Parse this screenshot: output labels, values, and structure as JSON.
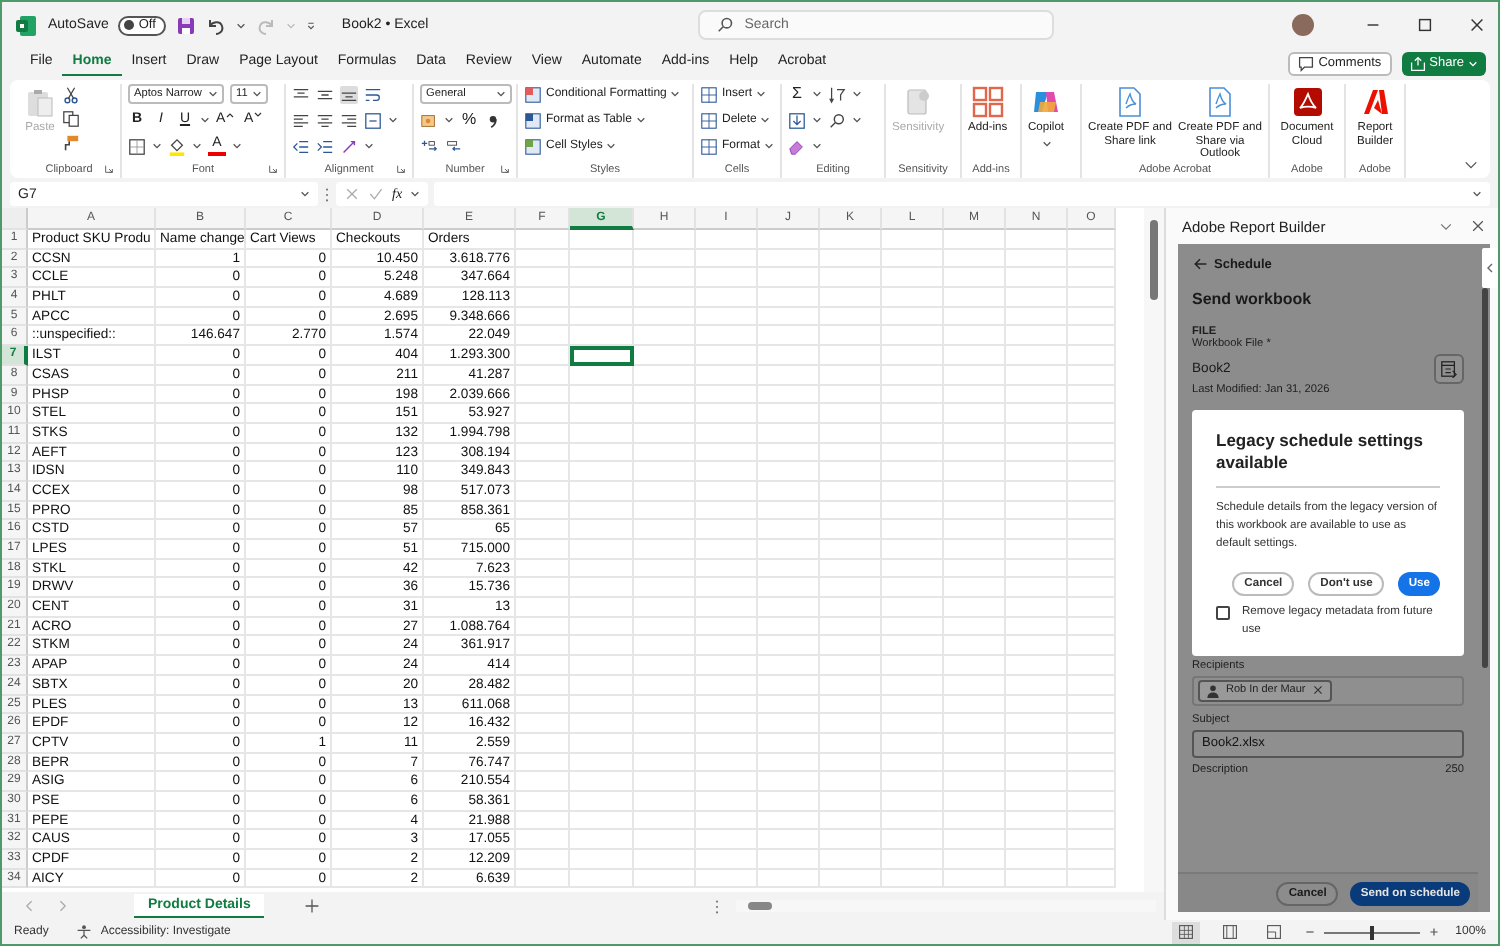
{
  "titlebar": {
    "autosave_label": "AutoSave",
    "autosave": {
      "on": false,
      "label": "Off"
    },
    "document_title": "Book2 • Excel",
    "search": {
      "placeholder": "Search"
    }
  },
  "menu_tabs": [
    {
      "label": "File",
      "selected": false
    },
    {
      "label": "Home",
      "selected": true
    },
    {
      "label": "Insert",
      "selected": false
    },
    {
      "label": "Draw",
      "selected": false
    },
    {
      "label": "Page Layout",
      "selected": false
    },
    {
      "label": "Formulas",
      "selected": false
    },
    {
      "label": "Data",
      "selected": false
    },
    {
      "label": "Review",
      "selected": false
    },
    {
      "label": "View",
      "selected": false
    },
    {
      "label": "Automate",
      "selected": false
    },
    {
      "label": "Add-ins",
      "selected": false
    },
    {
      "label": "Help",
      "selected": false
    },
    {
      "label": "Acrobat",
      "selected": false
    }
  ],
  "comments_button": "Comments",
  "share_button": "Share",
  "ribbon": {
    "clipboard": {
      "paste": {
        "label": "Paste",
        "disabled": true
      },
      "label": "Clipboard"
    },
    "font": {
      "family": "Aptos Narrow",
      "size": "11",
      "bold": "B",
      "italic": "I",
      "underline": "U",
      "grow": "A",
      "shrink": "A",
      "font_color_button": "A",
      "label": "Font"
    },
    "alignment": {
      "label": "Alignment"
    },
    "number": {
      "format": "General",
      "percent": "%",
      "label": "Number"
    },
    "styles": {
      "items": [
        "Conditional Formatting",
        "Format as Table",
        "Cell Styles"
      ],
      "label": "Styles"
    },
    "cells": {
      "items": [
        "Insert",
        "Delete",
        "Format"
      ],
      "label": "Cells"
    },
    "editing": {
      "autosum": "Σ",
      "label": "Editing"
    },
    "sensitivity": {
      "button": "Sensitivity",
      "disabled": true,
      "label": "Sensitivity"
    },
    "addins": {
      "button": "Add-ins",
      "label": "Add-ins"
    },
    "copilot": {
      "button": "Copilot"
    },
    "acrobat": {
      "buttons": [
        "Create PDF and Share link",
        "Create PDF and Share via Outlook"
      ],
      "label": "Adobe Acrobat"
    },
    "adobe": [
      {
        "button": "Document Cloud",
        "label": "Adobe"
      },
      {
        "button": "Report Builder",
        "label": "Adobe"
      }
    ]
  },
  "formula_bar": {
    "name_box": "G7",
    "function_label": "fx"
  },
  "sheet": {
    "columns": [
      {
        "label": "A",
        "selected": false
      },
      {
        "label": "B",
        "selected": false
      },
      {
        "label": "C",
        "selected": false
      },
      {
        "label": "D",
        "selected": false
      },
      {
        "label": "E",
        "selected": false
      },
      {
        "label": "F",
        "selected": false
      },
      {
        "label": "G",
        "selected": true
      },
      {
        "label": "H",
        "selected": false
      },
      {
        "label": "I",
        "selected": false
      },
      {
        "label": "J",
        "selected": false
      },
      {
        "label": "K",
        "selected": false
      },
      {
        "label": "L",
        "selected": false
      },
      {
        "label": "M",
        "selected": false
      },
      {
        "label": "N",
        "selected": false
      },
      {
        "label": "O",
        "selected": false
      }
    ],
    "rows": [
      {
        "number": "1",
        "selected": false,
        "cells": [
          "Product SKU Produ",
          "Name change",
          "Cart Views",
          "Checkouts",
          "Orders"
        ]
      },
      {
        "number": "2",
        "selected": false,
        "cells": [
          "CCSN",
          "1",
          "0",
          "10.450",
          "3.618.776"
        ]
      },
      {
        "number": "3",
        "selected": false,
        "cells": [
          "CCLE",
          "0",
          "0",
          "5.248",
          "347.664"
        ]
      },
      {
        "number": "4",
        "selected": false,
        "cells": [
          "PHLT",
          "0",
          "0",
          "4.689",
          "128.113"
        ]
      },
      {
        "number": "5",
        "selected": false,
        "cells": [
          "APCC",
          "0",
          "0",
          "2.695",
          "9.348.666"
        ]
      },
      {
        "number": "6",
        "selected": false,
        "cells": [
          "::unspecified::",
          "146.647",
          "2.770",
          "1.574",
          "22.049"
        ]
      },
      {
        "number": "7",
        "selected": true,
        "cells": [
          "ILST",
          "0",
          "0",
          "404",
          "1.293.300"
        ]
      },
      {
        "number": "8",
        "selected": false,
        "cells": [
          "CSAS",
          "0",
          "0",
          "211",
          "41.287"
        ]
      },
      {
        "number": "9",
        "selected": false,
        "cells": [
          "PHSP",
          "0",
          "0",
          "198",
          "2.039.666"
        ]
      },
      {
        "number": "10",
        "selected": false,
        "cells": [
          "STEL",
          "0",
          "0",
          "151",
          "53.927"
        ]
      },
      {
        "number": "11",
        "selected": false,
        "cells": [
          "STKS",
          "0",
          "0",
          "132",
          "1.994.798"
        ]
      },
      {
        "number": "12",
        "selected": false,
        "cells": [
          "AEFT",
          "0",
          "0",
          "123",
          "308.194"
        ]
      },
      {
        "number": "13",
        "selected": false,
        "cells": [
          "IDSN",
          "0",
          "0",
          "110",
          "349.843"
        ]
      },
      {
        "number": "14",
        "selected": false,
        "cells": [
          "CCEX",
          "0",
          "0",
          "98",
          "517.073"
        ]
      },
      {
        "number": "15",
        "selected": false,
        "cells": [
          "PPRO",
          "0",
          "0",
          "85",
          "858.361"
        ]
      },
      {
        "number": "16",
        "selected": false,
        "cells": [
          "CSTD",
          "0",
          "0",
          "57",
          "65"
        ]
      },
      {
        "number": "17",
        "selected": false,
        "cells": [
          "LPES",
          "0",
          "0",
          "51",
          "715.000"
        ]
      },
      {
        "number": "18",
        "selected": false,
        "cells": [
          "STKL",
          "0",
          "0",
          "42",
          "7.623"
        ]
      },
      {
        "number": "19",
        "selected": false,
        "cells": [
          "DRWV",
          "0",
          "0",
          "36",
          "15.736"
        ]
      },
      {
        "number": "20",
        "selected": false,
        "cells": [
          "CENT",
          "0",
          "0",
          "31",
          "13"
        ]
      },
      {
        "number": "21",
        "selected": false,
        "cells": [
          "ACRO",
          "0",
          "0",
          "27",
          "1.088.764"
        ]
      },
      {
        "number": "22",
        "selected": false,
        "cells": [
          "STKM",
          "0",
          "0",
          "24",
          "361.917"
        ]
      },
      {
        "number": "23",
        "selected": false,
        "cells": [
          "APAP",
          "0",
          "0",
          "24",
          "414"
        ]
      },
      {
        "number": "24",
        "selected": false,
        "cells": [
          "SBTX",
          "0",
          "0",
          "20",
          "28.482"
        ]
      },
      {
        "number": "25",
        "selected": false,
        "cells": [
          "PLES",
          "0",
          "0",
          "13",
          "611.068"
        ]
      },
      {
        "number": "26",
        "selected": false,
        "cells": [
          "EPDF",
          "0",
          "0",
          "12",
          "16.432"
        ]
      },
      {
        "number": "27",
        "selected": false,
        "cells": [
          "CPTV",
          "0",
          "1",
          "11",
          "2.559"
        ]
      },
      {
        "number": "28",
        "selected": false,
        "cells": [
          "BEPR",
          "0",
          "0",
          "7",
          "76.747"
        ]
      },
      {
        "number": "29",
        "selected": false,
        "cells": [
          "ASIG",
          "0",
          "0",
          "6",
          "210.554"
        ]
      },
      {
        "number": "30",
        "selected": false,
        "cells": [
          "PSE",
          "0",
          "0",
          "6",
          "58.361"
        ]
      },
      {
        "number": "31",
        "selected": false,
        "cells": [
          "PEPE",
          "0",
          "0",
          "4",
          "21.988"
        ]
      },
      {
        "number": "32",
        "selected": false,
        "cells": [
          "CAUS",
          "0",
          "0",
          "3",
          "17.055"
        ]
      },
      {
        "number": "33",
        "selected": false,
        "cells": [
          "CPDF",
          "0",
          "0",
          "2",
          "12.209"
        ]
      },
      {
        "number": "34",
        "selected": false,
        "cells": [
          "AICY",
          "0",
          "0",
          "2",
          "6.639"
        ]
      }
    ]
  },
  "sheet_tabs": [
    {
      "label": "Product Details",
      "selected": true
    }
  ],
  "status_bar": {
    "status": "Ready",
    "accessibility": "Accessibility: Investigate",
    "views": [
      {
        "selected": true
      },
      {
        "selected": false
      },
      {
        "selected": false
      }
    ],
    "zoom_slider": {
      "level": 0.5
    },
    "zoom": "100%"
  },
  "task_pane": {
    "title": "Adobe Report Builder",
    "back_link": "Schedule",
    "heading": "Send workbook",
    "file_section": "FILE",
    "file_label": "Workbook File *",
    "file_name": "Book2",
    "last_modified": "Last Modified: Jan 31, 2026",
    "dialog": {
      "title": "Legacy schedule settings available",
      "body": "Schedule details from the legacy version of this workbook are available to use as default settings.",
      "buttons": [
        {
          "label": "Cancel",
          "kind": "secondary"
        },
        {
          "label": "Don't use",
          "kind": "secondary"
        },
        {
          "label": "Use",
          "kind": "primary"
        }
      ],
      "checkbox": {
        "label": "Remove legacy metadata from future use",
        "checked": false
      }
    },
    "recipients_label": "Recipients",
    "recipients": [
      {
        "name": "Rob In der Maur"
      }
    ],
    "subject_label": "Subject",
    "subject": "Book2.xlsx",
    "description_label": "Description",
    "description_count": "250",
    "footer_buttons": [
      {
        "label": "Cancel",
        "kind": "secondary"
      },
      {
        "label": "Send on schedule",
        "kind": "primary"
      }
    ]
  }
}
